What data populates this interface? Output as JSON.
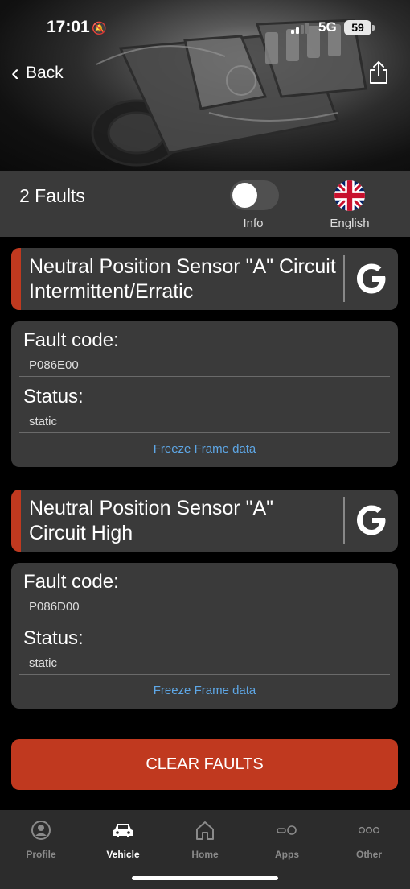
{
  "status_bar": {
    "time": "17:01",
    "network": "5G",
    "battery": "59"
  },
  "nav": {
    "back_label": "Back"
  },
  "faults_header": {
    "count_label": "2 Faults",
    "info_label": "Info",
    "language_label": "English",
    "info_toggle_on": false
  },
  "faults": [
    {
      "title": "Neutral Position Sensor \"A\" Circuit Intermittent/Erratic",
      "fault_code_label": "Fault code:",
      "fault_code": "P086E00",
      "status_label": "Status:",
      "status": "static",
      "freeze_frame_label": "Freeze Frame data"
    },
    {
      "title": "Neutral Position Sensor \"A\" Circuit High",
      "fault_code_label": "Fault code:",
      "fault_code": "P086D00",
      "status_label": "Status:",
      "status": "static",
      "freeze_frame_label": "Freeze Frame data"
    }
  ],
  "clear_button_label": "CLEAR FAULTS",
  "tabs": [
    {
      "label": "Profile",
      "icon": "profile-icon",
      "active": false
    },
    {
      "label": "Vehicle",
      "icon": "car-icon",
      "active": true
    },
    {
      "label": "Home",
      "icon": "home-icon",
      "active": false
    },
    {
      "label": "Apps",
      "icon": "apps-icon",
      "active": false
    },
    {
      "label": "Other",
      "icon": "more-icon",
      "active": false
    }
  ],
  "colors": {
    "accent_red": "#c0391f",
    "link_blue": "#5ea7e6",
    "card_bg": "#3a3a3a"
  }
}
